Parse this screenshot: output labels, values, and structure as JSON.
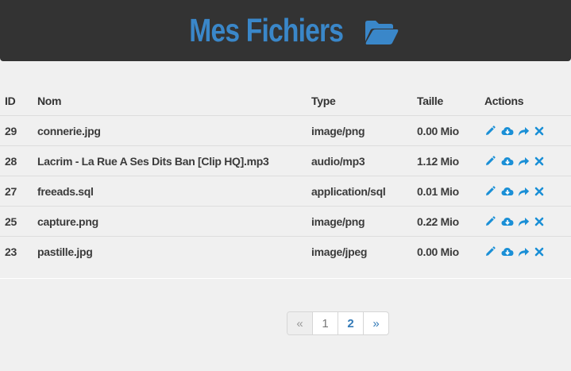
{
  "header": {
    "title": "Mes Fichiers",
    "icon": "folder-open-icon",
    "accent_color": "#3a87c9",
    "background": "#333333"
  },
  "table": {
    "columns": [
      "ID",
      "Nom",
      "Type",
      "Taille",
      "Actions"
    ],
    "rows": [
      {
        "id": "29",
        "name": "connerie.jpg",
        "type": "image/png",
        "size": "0.00 Mio"
      },
      {
        "id": "28",
        "name": "Lacrim - La Rue A Ses Dits Ban [Clip HQ].mp3",
        "type": "audio/mp3",
        "size": "1.12 Mio"
      },
      {
        "id": "27",
        "name": "freeads.sql",
        "type": "application/sql",
        "size": "0.01 Mio"
      },
      {
        "id": "25",
        "name": "capture.png",
        "type": "image/png",
        "size": "0.22 Mio"
      },
      {
        "id": "23",
        "name": "pastille.jpg",
        "type": "image/jpeg",
        "size": "0.00 Mio"
      }
    ],
    "action_icons": [
      "pencil-icon",
      "cloud-download-icon",
      "share-icon",
      "delete-icon"
    ],
    "action_color": "#1a8fd6"
  },
  "pagination": {
    "prev": "«",
    "pages": [
      "1",
      "2"
    ],
    "current_page": "2",
    "next": "»"
  }
}
